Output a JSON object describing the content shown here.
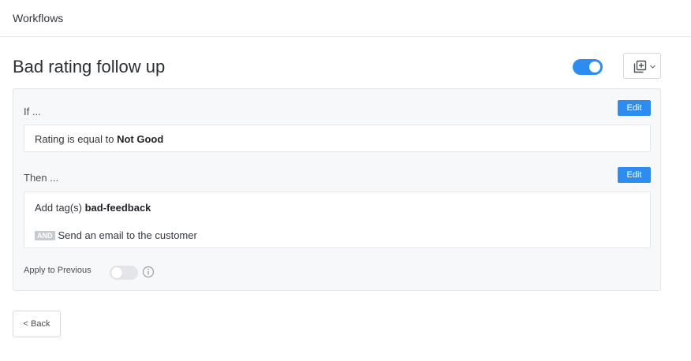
{
  "breadcrumb": {
    "label": "Workflows"
  },
  "header": {
    "title": "Bad rating follow up",
    "enabled": true,
    "duplicate_icon": "duplicate-icon",
    "dropdown_icon": "chevron-down-icon"
  },
  "conditions": {
    "label": "If ...",
    "edit_label": "Edit",
    "rule": {
      "prefix": "Rating is equal to",
      "value": "Not Good"
    }
  },
  "actions": {
    "label": "Then ...",
    "edit_label": "Edit",
    "first": {
      "prefix": "Add tag(s)",
      "value": "bad-feedback"
    },
    "second": {
      "connector": "AND",
      "text": "Send an email to the customer"
    }
  },
  "apply_previous": {
    "label": "Apply to Previous",
    "enabled": false,
    "info_icon": "info-icon"
  },
  "footer": {
    "back_label": "< Back"
  },
  "colors": {
    "accent": "#2d8cf0",
    "panel_bg": "#f7f8fa",
    "badge_bg": "#c6cbd1"
  }
}
